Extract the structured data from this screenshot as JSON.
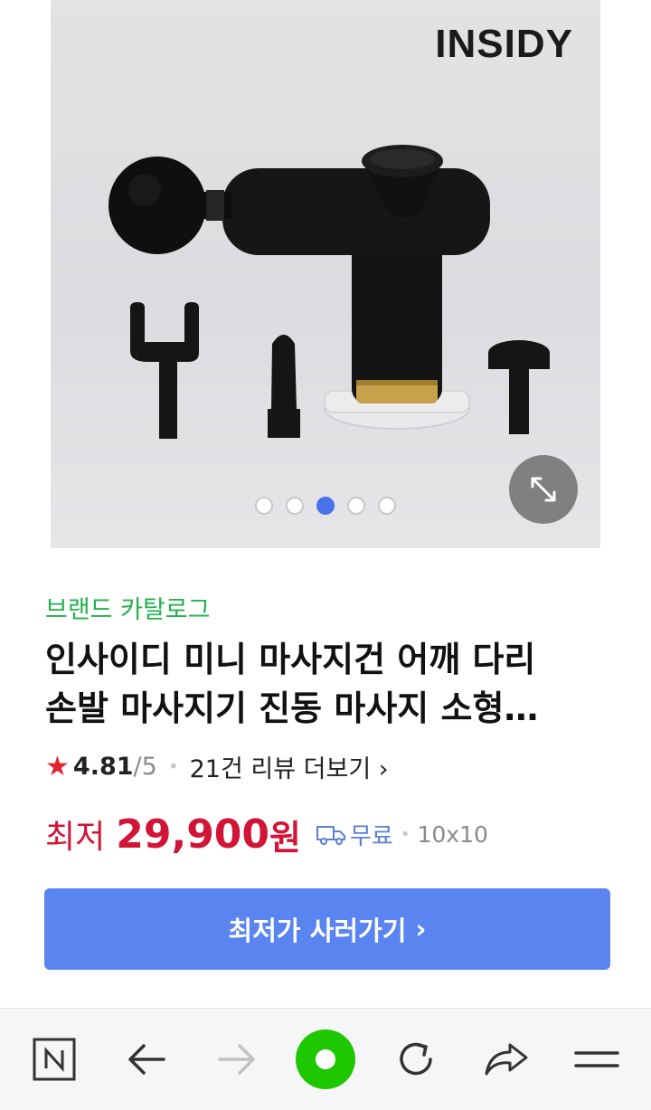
{
  "gallery": {
    "brand_logo_text": "INSIDY",
    "slide_count": 5,
    "active_slide_index": 2,
    "expand_icon": "expand-diagonal-icon"
  },
  "product": {
    "catalog_link": "브랜드 카탈로그",
    "title": "인사이디 미니 마사지건 어깨 다리 손발 마사지기 진동 마사지 소형 휴대용",
    "rating": "4.81",
    "rating_max": "/5",
    "reviews_link": "21건 리뷰 더보기",
    "price_label": "최저",
    "price": "29,900",
    "price_unit": "원",
    "shipping": "무료",
    "extra_info": "10x10",
    "buy_button": "최저가 사러가기"
  },
  "bottom_nav": {
    "items": [
      "naver-home-icon",
      "back-arrow-icon",
      "forward-arrow-icon",
      "green-dot-icon",
      "refresh-icon",
      "share-icon",
      "menu-icon"
    ],
    "forward_enabled": false
  },
  "colors": {
    "catalog_green": "#22b14c",
    "price_red": "#d21437",
    "button_blue": "#5a84ef",
    "active_dot": "#4a72ea",
    "nav_green": "#1ec800"
  }
}
